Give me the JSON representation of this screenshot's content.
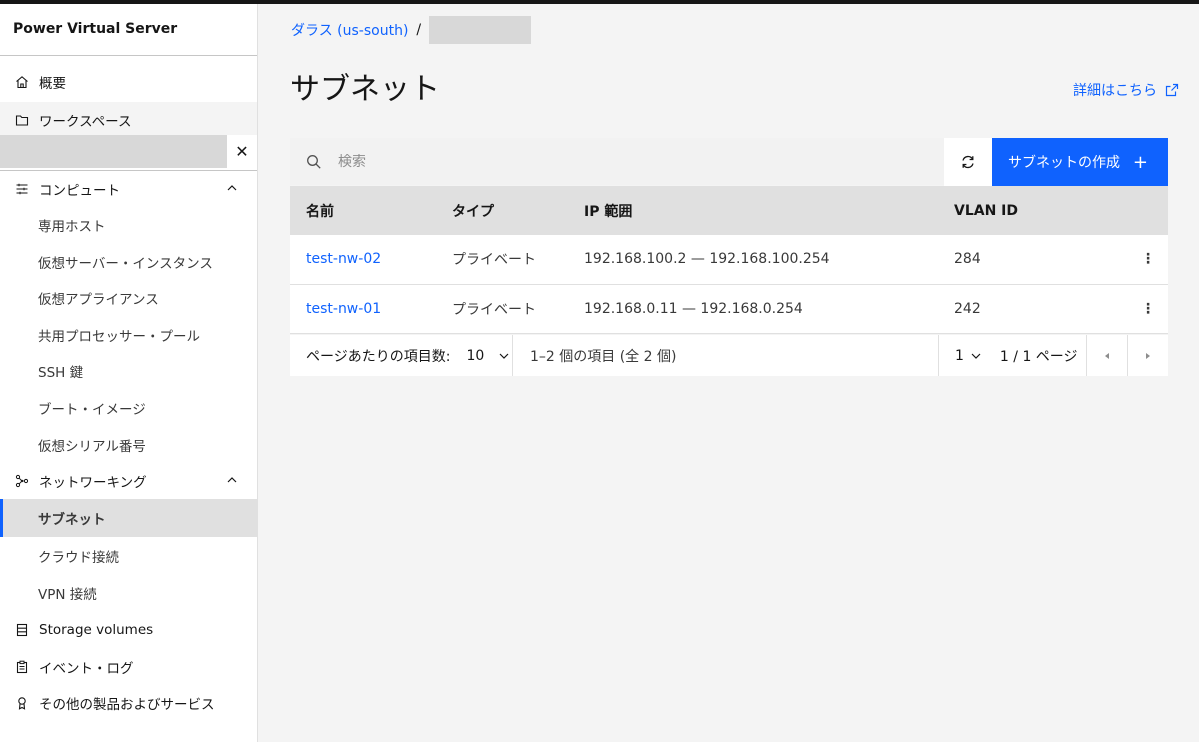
{
  "sidebar": {
    "title": "Power Virtual Server",
    "overview": "概要",
    "workspaces": "ワークスペース",
    "compute_header": "コンピュート",
    "compute_items": [
      "専用ホスト",
      "仮想サーバー・インスタンス",
      "仮想アプライアンス",
      "共用プロセッサー・プール",
      "SSH 鍵",
      "ブート・イメージ",
      "仮想シリアル番号"
    ],
    "networking_header": "ネットワーキング",
    "networking_items": [
      "サブネット",
      "クラウド接続",
      "VPN 接続"
    ],
    "storage": "Storage volumes",
    "events": "イベント・ログ",
    "other": "その他の製品およびサービス"
  },
  "breadcrumb": {
    "location": "ダラス (us-south)",
    "separator": "/"
  },
  "page": {
    "title": "サブネット",
    "learn_more": "詳細はこちら"
  },
  "toolbar": {
    "search_placeholder": "検索",
    "create_label": "サブネットの作成",
    "create_icon": "+"
  },
  "table": {
    "headers": {
      "name": "名前",
      "type": "タイプ",
      "ip_range": "IP 範囲",
      "vlan_id": "VLAN ID"
    },
    "rows": [
      {
        "name": "test-nw-02",
        "type": "プライベート",
        "ip_range": "192.168.100.2 — 192.168.100.254",
        "vlan_id": "284",
        "menu": "⋮"
      },
      {
        "name": "test-nw-01",
        "type": "プライベート",
        "ip_range": "192.168.0.11 — 192.168.0.254",
        "vlan_id": "242",
        "menu": "⋮"
      }
    ]
  },
  "pagination": {
    "items_per_page_label": "ページあたりの項目数:",
    "page_size": "10",
    "range_text": "1–2 個の項目 (全 2 個)",
    "current_page": "1",
    "page_of": "1 / 1 ページ"
  },
  "colors": {
    "accent": "#0f62fe",
    "sidebar_active": "#e0e0e0",
    "background": "#f4f4f4"
  }
}
